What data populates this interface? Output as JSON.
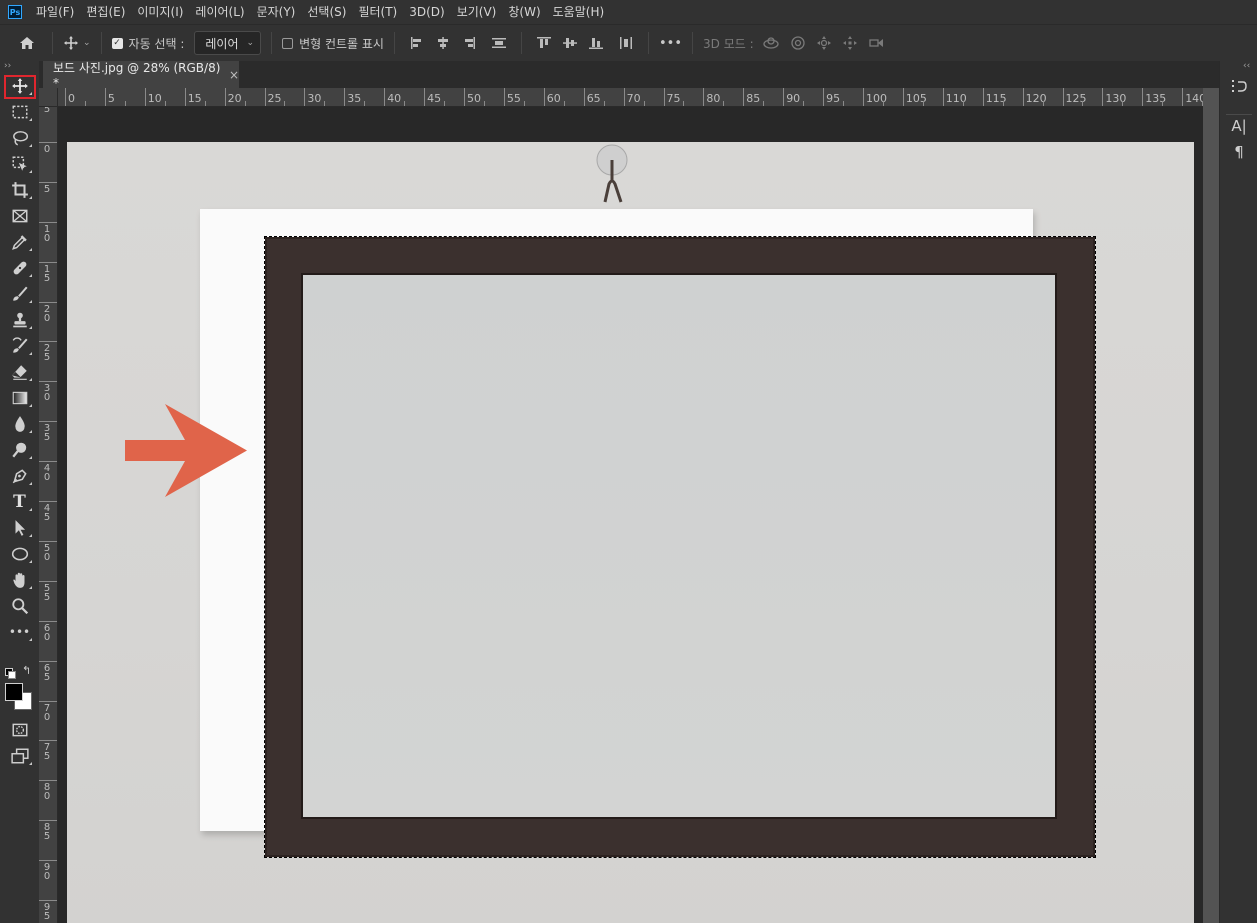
{
  "menu": {
    "logo": "Ps",
    "items": [
      "파일(F)",
      "편집(E)",
      "이미지(I)",
      "레이어(L)",
      "문자(Y)",
      "선택(S)",
      "필터(T)",
      "3D(D)",
      "보기(V)",
      "창(W)",
      "도움말(H)"
    ]
  },
  "options": {
    "home_icon": "home-icon",
    "move_icon": "move-tool-icon",
    "auto_select_checked": true,
    "auto_select_label": "자동 선택 :",
    "layer_select_value": "레이어",
    "transform_checked": false,
    "transform_label": "변형 컨트롤 표시",
    "more_label": "•••",
    "mode_3d_label": "3D 모드 :"
  },
  "document": {
    "tab_title": "보드 사진.jpg @ 28% (RGB/8) *",
    "close_glyph": "×"
  },
  "ruler": {
    "top_labels": [
      "0",
      "5",
      "10",
      "15",
      "20",
      "25",
      "30",
      "35",
      "40",
      "45",
      "50",
      "55",
      "60",
      "65",
      "70",
      "75",
      "80",
      "85",
      "90",
      "95",
      "100",
      "105",
      "110",
      "115",
      "120",
      "125",
      "130",
      "135",
      "140"
    ],
    "left_labels": [
      "5",
      "0",
      "5",
      "10",
      "15",
      "20",
      "25",
      "30",
      "35",
      "40",
      "45",
      "50",
      "55",
      "60",
      "65",
      "70",
      "75",
      "80",
      "85",
      "90",
      "95"
    ]
  },
  "toolbar": {
    "tools": [
      "move-tool",
      "marquee-tool",
      "lasso-tool",
      "object-select-tool",
      "crop-tool",
      "frame-tool",
      "eyedropper-tool",
      "healing-brush-tool",
      "brush-tool",
      "clone-stamp-tool",
      "history-brush-tool",
      "eraser-tool",
      "gradient-tool",
      "blur-tool",
      "dodge-tool",
      "pen-tool",
      "type-tool",
      "path-select-tool",
      "ellipse-tool",
      "hand-tool",
      "zoom-tool",
      "more-tools"
    ],
    "type_glyph": "T",
    "more_glyph": "•••",
    "foreground_color": "#000000",
    "background_color": "#ffffff"
  },
  "right_dock": {
    "character_label": "A|",
    "paragraph_label": "¶"
  },
  "colors": {
    "arrow": "#e0644a",
    "frame": "#3b302e",
    "selection_active": "#e0262e"
  }
}
